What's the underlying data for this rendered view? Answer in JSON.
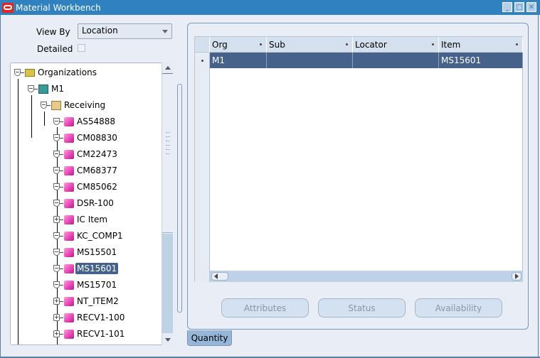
{
  "window": {
    "title": "Material Workbench",
    "controls": [
      "minimize-icon",
      "maximize-icon",
      "close-icon"
    ]
  },
  "filters": {
    "view_by_label": "View By",
    "view_by_value": "Location",
    "detailed_label": "Detailed",
    "detailed_checked": false
  },
  "tree": {
    "nodes": [
      {
        "label": "Organizations",
        "icon": "folder-icon",
        "level": 0,
        "state": "expanded"
      },
      {
        "label": "M1",
        "icon": "organization-icon",
        "level": 1,
        "state": "expanded"
      },
      {
        "label": "Receiving",
        "icon": "receiving-icon",
        "level": 2,
        "state": "expanded"
      },
      {
        "label": "AS54888",
        "icon": "item-cube-icon",
        "level": 3,
        "state": "expanded"
      },
      {
        "label": "CM08830",
        "icon": "item-cube-icon",
        "level": 3,
        "state": "expanded"
      },
      {
        "label": "CM22473",
        "icon": "item-cube-icon",
        "level": 3,
        "state": "expanded"
      },
      {
        "label": "CM68377",
        "icon": "item-cube-icon",
        "level": 3,
        "state": "expanded"
      },
      {
        "label": "CM85062",
        "icon": "item-cube-icon",
        "level": 3,
        "state": "expanded"
      },
      {
        "label": "DSR-100",
        "icon": "item-cube-icon",
        "level": 3,
        "state": "expanded"
      },
      {
        "label": "IC Item",
        "icon": "item-cube-icon",
        "level": 3,
        "state": "collapsed"
      },
      {
        "label": "KC_COMP1",
        "icon": "item-cube-icon",
        "level": 3,
        "state": "expanded"
      },
      {
        "label": "MS15501",
        "icon": "item-cube-icon",
        "level": 3,
        "state": "expanded"
      },
      {
        "label": "MS15601",
        "icon": "item-cube-icon",
        "level": 3,
        "state": "expanded",
        "selected": true
      },
      {
        "label": "MS15701",
        "icon": "item-cube-icon",
        "level": 3,
        "state": "expanded"
      },
      {
        "label": "NT_ITEM2",
        "icon": "item-cube-icon",
        "level": 3,
        "state": "collapsed"
      },
      {
        "label": "RECV1-100",
        "icon": "item-cube-icon",
        "level": 3,
        "state": "collapsed"
      },
      {
        "label": "RECV1-101",
        "icon": "item-cube-icon",
        "level": 3,
        "state": "collapsed"
      }
    ]
  },
  "grid": {
    "columns": [
      "Org",
      "Sub",
      "Locator",
      "Item"
    ],
    "rows": [
      {
        "Org": "M1",
        "Sub": "",
        "Locator": "",
        "Item": "MS15601",
        "selected": true
      }
    ]
  },
  "buttons": {
    "attributes": "Attributes",
    "status": "Status",
    "availability": "Availability"
  },
  "tabs": {
    "active": "Quantity"
  },
  "colors": {
    "titlebar": "#2f81bf",
    "selection": "#46628a",
    "background": "#e9eef6"
  }
}
